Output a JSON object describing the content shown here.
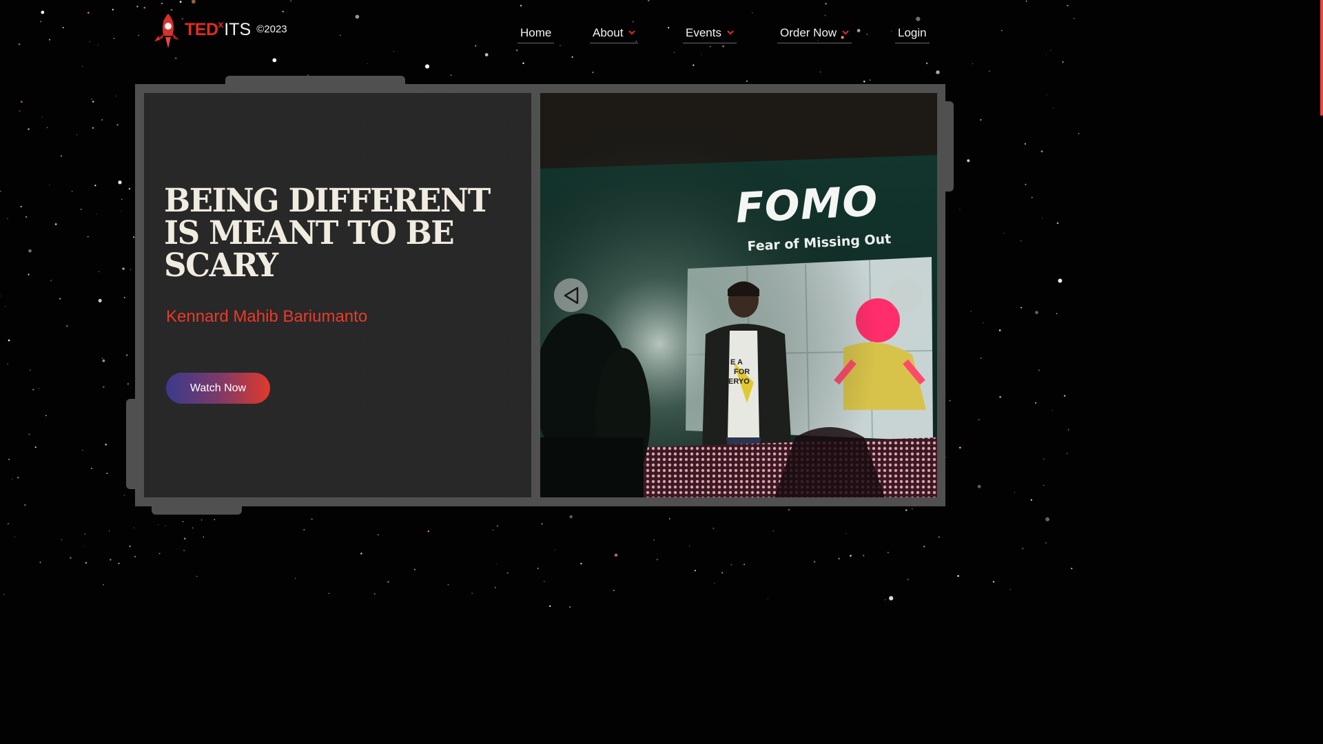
{
  "brand": {
    "ted": "TED",
    "x": "x",
    "its": "ITS",
    "year": "©2023",
    "logo_icon": "rocket-icon",
    "accent_color": "#e62b1e"
  },
  "nav": {
    "items": [
      {
        "label": "Home",
        "has_dropdown": false
      },
      {
        "label": "About",
        "has_dropdown": true
      },
      {
        "label": "Events",
        "has_dropdown": true
      },
      {
        "label": "Order Now",
        "has_dropdown": true
      },
      {
        "label": "Login",
        "has_dropdown": false
      }
    ],
    "dropdown_icon": "chevron-down-icon",
    "dropdown_color": "#e62b1e"
  },
  "hero": {
    "headline_lines": [
      "BEING DIFFERENT",
      "IS MEANT TO BE",
      "SCARY"
    ],
    "speaker": "Kennard Mahib Bariumanto",
    "speaker_color": "#ec3a2a",
    "cta_label": "Watch Now"
  },
  "slide": {
    "screen_title": "FOMO",
    "screen_subtitle": "Fear of Missing Out",
    "shirt_text": [
      "E A",
      "FOR",
      "ERYO"
    ],
    "prev_icon": "triangle-left-icon",
    "next_icon": "triangle-right-icon"
  }
}
